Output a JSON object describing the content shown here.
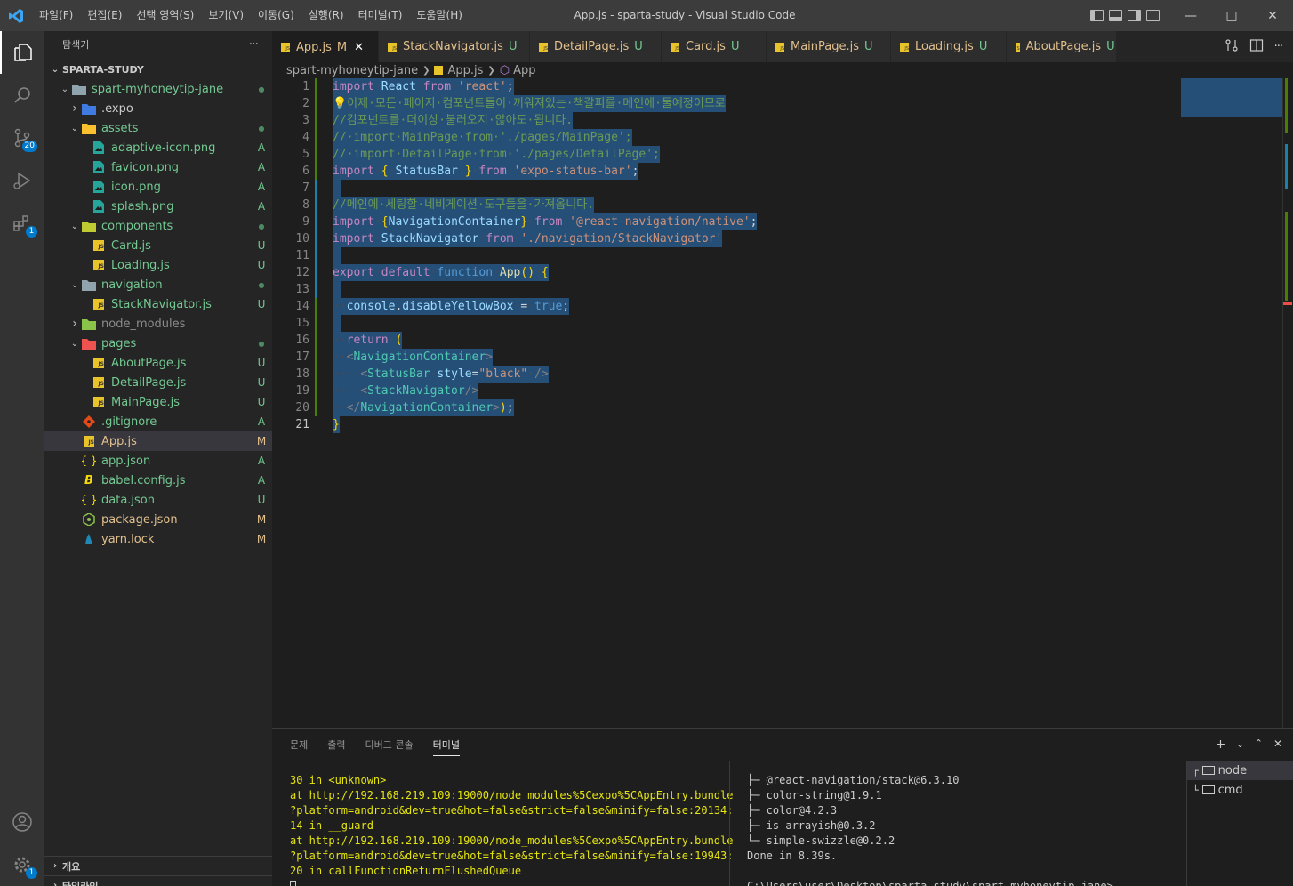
{
  "titlebar": {
    "menu": [
      "파일(F)",
      "편집(E)",
      "선택 영역(S)",
      "보기(V)",
      "이동(G)",
      "실행(R)",
      "터미널(T)",
      "도움말(H)"
    ],
    "title": "App.js - sparta-study - Visual Studio Code"
  },
  "activitybar": {
    "scm_badge": "20",
    "extensions_badge": "1",
    "settings_badge": "1"
  },
  "sidebar": {
    "header": "탐색기",
    "more": "···",
    "root": "SPARTA-STUDY",
    "tree": [
      {
        "label": "spart-myhoneytip-jane",
        "depth": 1,
        "type": "folder",
        "open": true,
        "status": "●",
        "color": "#73c991"
      },
      {
        "label": ".expo",
        "depth": 2,
        "type": "folder-expo",
        "open": false,
        "status": "",
        "color": "#cccccc"
      },
      {
        "label": "assets",
        "depth": 2,
        "type": "folder-assets",
        "open": true,
        "status": "●",
        "color": "#73c991"
      },
      {
        "label": "adaptive-icon.png",
        "depth": 3,
        "type": "png",
        "status": "A",
        "color": "#73c991"
      },
      {
        "label": "favicon.png",
        "depth": 3,
        "type": "png",
        "status": "A",
        "color": "#73c991"
      },
      {
        "label": "icon.png",
        "depth": 3,
        "type": "png",
        "status": "A",
        "color": "#73c991"
      },
      {
        "label": "splash.png",
        "depth": 3,
        "type": "png",
        "status": "A",
        "color": "#73c991"
      },
      {
        "label": "components",
        "depth": 2,
        "type": "folder-components",
        "open": true,
        "status": "●",
        "color": "#73c991"
      },
      {
        "label": "Card.js",
        "depth": 3,
        "type": "js",
        "status": "U",
        "color": "#73c991"
      },
      {
        "label": "Loading.js",
        "depth": 3,
        "type": "js",
        "status": "U",
        "color": "#73c991"
      },
      {
        "label": "navigation",
        "depth": 2,
        "type": "folder",
        "open": true,
        "status": "●",
        "color": "#73c991"
      },
      {
        "label": "StackNavigator.js",
        "depth": 3,
        "type": "js",
        "status": "U",
        "color": "#73c991"
      },
      {
        "label": "node_modules",
        "depth": 2,
        "type": "folder-node",
        "open": false,
        "status": "",
        "color": "#8c8c8c"
      },
      {
        "label": "pages",
        "depth": 2,
        "type": "folder-pages",
        "open": true,
        "status": "●",
        "color": "#73c991"
      },
      {
        "label": "AboutPage.js",
        "depth": 3,
        "type": "js",
        "status": "U",
        "color": "#73c991"
      },
      {
        "label": "DetailPage.js",
        "depth": 3,
        "type": "js",
        "status": "U",
        "color": "#73c991"
      },
      {
        "label": "MainPage.js",
        "depth": 3,
        "type": "js",
        "status": "U",
        "color": "#73c991"
      },
      {
        "label": ".gitignore",
        "depth": 2,
        "type": "git",
        "status": "A",
        "color": "#73c991"
      },
      {
        "label": "App.js",
        "depth": 2,
        "type": "js",
        "status": "M",
        "color": "#e2c08d",
        "selected": true
      },
      {
        "label": "app.json",
        "depth": 2,
        "type": "json",
        "status": "A",
        "color": "#73c991"
      },
      {
        "label": "babel.config.js",
        "depth": 2,
        "type": "babel",
        "status": "A",
        "color": "#73c991"
      },
      {
        "label": "data.json",
        "depth": 2,
        "type": "json",
        "status": "U",
        "color": "#73c991"
      },
      {
        "label": "package.json",
        "depth": 2,
        "type": "npm",
        "status": "M",
        "color": "#e2c08d"
      },
      {
        "label": "yarn.lock",
        "depth": 2,
        "type": "yarn",
        "status": "M",
        "color": "#e2c08d"
      }
    ],
    "footer_outline": "개요",
    "footer_timeline": "타임라인"
  },
  "tabs": [
    {
      "label": "App.js",
      "status": "M",
      "active": true
    },
    {
      "label": "StackNavigator.js",
      "status": "U"
    },
    {
      "label": "DetailPage.js",
      "status": "U"
    },
    {
      "label": "Card.js",
      "status": "U"
    },
    {
      "label": "MainPage.js",
      "status": "U"
    },
    {
      "label": "Loading.js",
      "status": "U"
    },
    {
      "label": "AboutPage.js",
      "status": "U"
    }
  ],
  "breadcrumb": {
    "folder": "spart-myhoneytip-jane",
    "file": "App.js",
    "symbol": "App"
  },
  "editor": {
    "lines": [
      "import·React·from·'react';",
      "💡이제·모든·페이지·컴포넌트들이·끼워져있는·책갈피를·메인에·둘예정이므로",
      "//컴포넌트를·더이상·불러오지·않아도·됩니다.",
      "//·import·MainPage·from·'./pages/MainPage';",
      "//·import·DetailPage·from·'./pages/DetailPage';",
      "import·{·StatusBar·}·from·'expo-status-bar';",
      "",
      "//메인에·세팅할·네비게이션·도구들을·가져옵니다.",
      "import·{NavigationContainer}·from·'@react-navigation/native';",
      "import·StackNavigator·from·'./navigation/StackNavigator'",
      "",
      "export·default·function·App()·{",
      "",
      "··console.disableYellowBox·=·true;",
      "",
      "··return·(",
      "··<NavigationContainer>",
      "····<StatusBar·style=\"black\"·/>",
      "····<StackNavigator/>",
      "··</NavigationContainer>);",
      "}"
    ],
    "current_line": 21
  },
  "panel": {
    "tabs": [
      "문제",
      "출력",
      "디버그 콘솔",
      "터미널"
    ],
    "active_tab": 3,
    "terminal_left": [
      "30 in <unknown>",
      "at http://192.168.219.109:19000/node_modules%5Cexpo%5CAppEntry.bundle",
      "?platform=android&dev=true&hot=false&strict=false&minify=false:20134:",
      "14 in __guard",
      "at http://192.168.219.109:19000/node_modules%5Cexpo%5CAppEntry.bundle",
      "?platform=android&dev=true&hot=false&strict=false&minify=false:19943:",
      "20 in callFunctionReturnFlushedQueue"
    ],
    "terminal_right": [
      "├─ @react-navigation/stack@6.3.10",
      "├─ color-string@1.9.1",
      "├─ color@4.2.3",
      "├─ is-arrayish@0.3.2",
      "└─ simple-swizzle@0.2.2",
      "Done in 8.39s.",
      "",
      "C:\\Users\\user\\Desktop\\sparta-study\\spart-myhoneytip-jane>"
    ],
    "terminals": [
      "node",
      "cmd"
    ]
  },
  "colors": {
    "accent": "#007acc",
    "modified": "#e2c08d",
    "untracked": "#73c991",
    "selection": "#264f78"
  }
}
